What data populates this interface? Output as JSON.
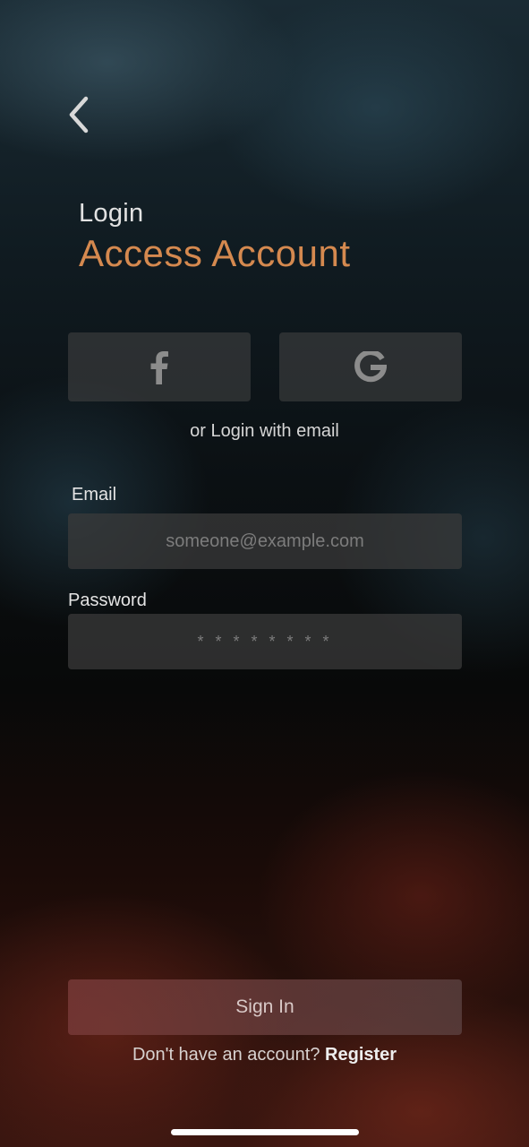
{
  "header": {
    "back_icon": "chevron-left-icon",
    "subtitle": "Login",
    "title": "Access Account"
  },
  "social": {
    "facebook_icon": "facebook-icon",
    "google_icon": "google-icon",
    "divider_text": "or Login with email"
  },
  "form": {
    "email_label": "Email",
    "email_placeholder": "someone@example.com",
    "password_label": "Password",
    "password_placeholder": "* * * * * * * *"
  },
  "actions": {
    "sign_in_label": "Sign In",
    "register_prompt": "Don't have an account?",
    "register_link": "Register"
  },
  "colors": {
    "accent": "#d5894f",
    "field_bg": "#3c3c3c",
    "button_bg": "#783a38"
  }
}
